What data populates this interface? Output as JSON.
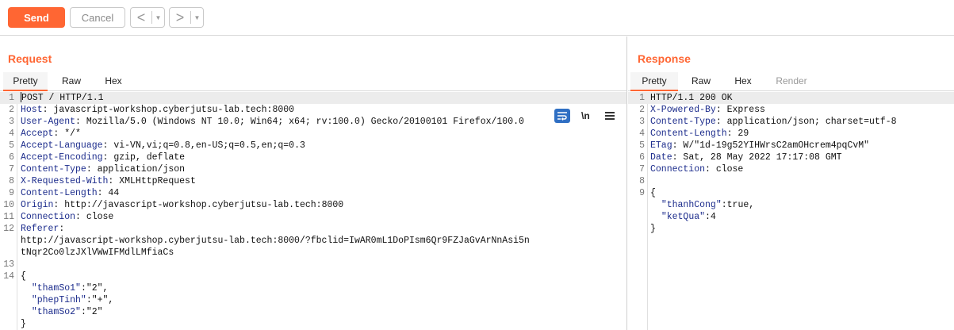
{
  "toolbar": {
    "send_label": "Send",
    "cancel_label": "Cancel",
    "back_glyph": "<",
    "forward_glyph": ">",
    "dropdown_glyph": "▼"
  },
  "request": {
    "title": "Request",
    "tabs": [
      "Pretty",
      "Raw",
      "Hex"
    ],
    "active_tab": "Pretty",
    "newline_toggle_label": "\\n",
    "icons": [
      "wrap-icon",
      "newline-icon",
      "menu-icon"
    ],
    "lines": [
      {
        "n": "1",
        "key": "",
        "text": "POST / HTTP/1.1"
      },
      {
        "n": "2",
        "key": "Host",
        "text": ": javascript-workshop.cyberjutsu-lab.tech:8000"
      },
      {
        "n": "3",
        "key": "User-Agent",
        "text": ": Mozilla/5.0 (Windows NT 10.0; Win64; x64; rv:100.0) Gecko/20100101 Firefox/100.0"
      },
      {
        "n": "4",
        "key": "Accept",
        "text": ": */*"
      },
      {
        "n": "5",
        "key": "Accept-Language",
        "text": ": vi-VN,vi;q=0.8,en-US;q=0.5,en;q=0.3"
      },
      {
        "n": "6",
        "key": "Accept-Encoding",
        "text": ": gzip, deflate"
      },
      {
        "n": "7",
        "key": "Content-Type",
        "text": ": application/json"
      },
      {
        "n": "8",
        "key": "X-Requested-With",
        "text": ": XMLHttpRequest"
      },
      {
        "n": "9",
        "key": "Content-Length",
        "text": ": 44"
      },
      {
        "n": "10",
        "key": "Origin",
        "text": ": http://javascript-workshop.cyberjutsu-lab.tech:8000"
      },
      {
        "n": "11",
        "key": "Connection",
        "text": ": close"
      },
      {
        "n": "12",
        "key": "Referer",
        "text": ":"
      },
      {
        "n": "",
        "key": "",
        "text": "http://javascript-workshop.cyberjutsu-lab.tech:8000/?fbclid=IwAR0mL1DoPIsm6Qr9FZJaGvArNnAsi5n"
      },
      {
        "n": "",
        "key": "",
        "text": "tNqr2Co0lzJXlVWwIFMdlLMfiaCs"
      },
      {
        "n": "13",
        "key": "",
        "text": ""
      },
      {
        "n": "14",
        "key": "",
        "text": "{"
      },
      {
        "n": "",
        "key": "",
        "text": "  ",
        "jkey": "\"thamSo1\"",
        "jval": ":\"2\","
      },
      {
        "n": "",
        "key": "",
        "text": "  ",
        "jkey": "\"phepTinh\"",
        "jval": ":\"+\","
      },
      {
        "n": "",
        "key": "",
        "text": "  ",
        "jkey": "\"thamSo2\"",
        "jval": ":\"2\""
      },
      {
        "n": "",
        "key": "",
        "text": "}"
      }
    ]
  },
  "response": {
    "title": "Response",
    "tabs": [
      "Pretty",
      "Raw",
      "Hex",
      "Render"
    ],
    "active_tab": "Pretty",
    "disabled_tab": "Render",
    "lines": [
      {
        "n": "1",
        "key": "",
        "text": "HTTP/1.1 200 OK"
      },
      {
        "n": "2",
        "key": "X-Powered-By",
        "text": ": Express"
      },
      {
        "n": "3",
        "key": "Content-Type",
        "text": ": application/json; charset=utf-8"
      },
      {
        "n": "4",
        "key": "Content-Length",
        "text": ": 29"
      },
      {
        "n": "5",
        "key": "ETag",
        "text": ": W/\"1d-19g52YIHWrsC2amOHcrem4pqCvM\""
      },
      {
        "n": "6",
        "key": "Date",
        "text": ": Sat, 28 May 2022 17:17:08 GMT"
      },
      {
        "n": "7",
        "key": "Connection",
        "text": ": close"
      },
      {
        "n": "8",
        "key": "",
        "text": ""
      },
      {
        "n": "9",
        "key": "",
        "text": "{"
      },
      {
        "n": "",
        "key": "",
        "text": "  ",
        "jkey": "\"thanhCong\"",
        "jval": ":true,"
      },
      {
        "n": "",
        "key": "",
        "text": "  ",
        "jkey": "\"ketQua\"",
        "jval": ":4"
      },
      {
        "n": "",
        "key": "",
        "text": "}"
      }
    ]
  },
  "colors": {
    "accent": "#ff6633",
    "header_key": "#1c2c8c",
    "wrap_icon_bg": "#2f6fc3"
  }
}
